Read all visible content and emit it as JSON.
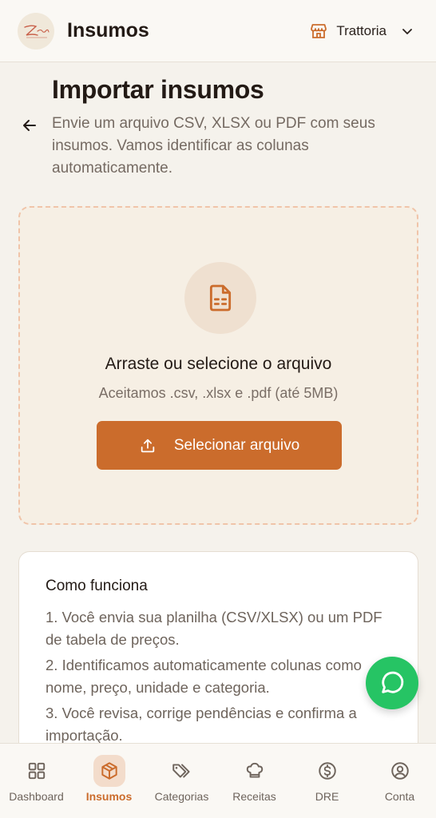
{
  "header": {
    "app_title": "Insumos",
    "restaurant_name": "Trattoria",
    "logo_text": "Zen"
  },
  "page": {
    "title": "Importar insumos",
    "description": "Envie um arquivo CSV, XLSX ou PDF com seus insumos. Vamos identificar as colunas automaticamente."
  },
  "dropzone": {
    "title": "Arraste ou selecione o arquivo",
    "subtitle": "Aceitamos .csv, .xlsx e .pdf (até 5MB)",
    "button_label": "Selecionar arquivo"
  },
  "how_it_works": {
    "title": "Como funciona",
    "steps": [
      "1. Você envia sua planilha (CSV/XLSX) ou um PDF de tabela de preços.",
      "2. Identificamos automaticamente colunas como nome, preço, unidade e categoria.",
      "3. Você revisa, corrige pendências e confirma a importação."
    ]
  },
  "nav": {
    "items": [
      {
        "label": "Dashboard",
        "icon": "grid-icon"
      },
      {
        "label": "Insumos",
        "icon": "box-icon",
        "active": true
      },
      {
        "label": "Categorias",
        "icon": "tags-icon"
      },
      {
        "label": "Receitas",
        "icon": "chef-hat-icon"
      },
      {
        "label": "DRE",
        "icon": "dollar-circle-icon"
      },
      {
        "label": "Conta",
        "icon": "user-circle-icon"
      }
    ]
  },
  "colors": {
    "accent": "#cb6c2c",
    "whatsapp": "#26c464",
    "background": "#f5f2ec"
  }
}
